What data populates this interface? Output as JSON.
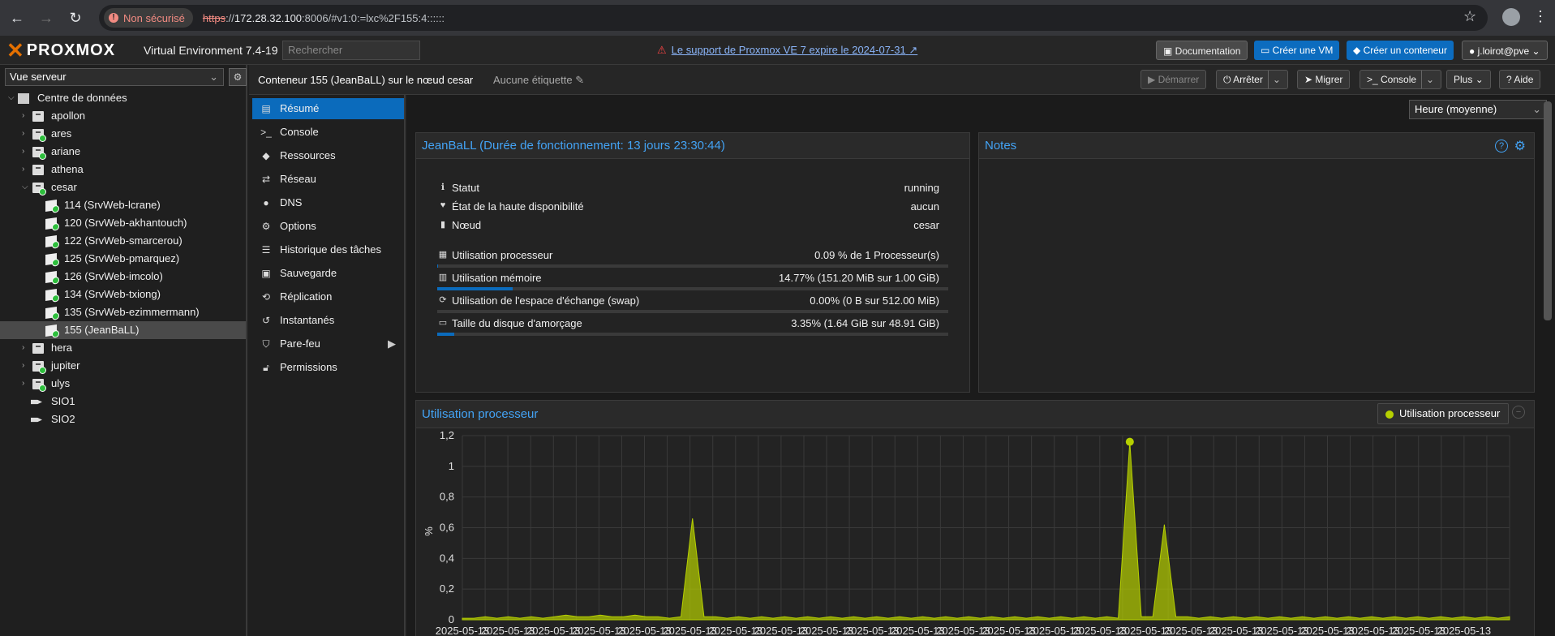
{
  "browser": {
    "insecure_label": "Non sécurisé",
    "url_protocol": "https",
    "url_host": "172.28.32.100",
    "url_rest": ":8006/#v1:0:=lxc%2F155:4::::::"
  },
  "header": {
    "product": "PROXMOX",
    "version": "Virtual Environment 7.4-19",
    "search_placeholder": "Rechercher",
    "support_notice": "Le support de Proxmox VE 7 expire le 2024-07-31",
    "documentation": "Documentation",
    "create_vm": "Créer une VM",
    "create_ct": "Créer un conteneur",
    "user": "j.loirot@pve"
  },
  "tree": {
    "view": "Vue serveur",
    "items": [
      {
        "label": "Centre de données"
      },
      {
        "label": "apollon"
      },
      {
        "label": "ares"
      },
      {
        "label": "ariane"
      },
      {
        "label": "athena"
      },
      {
        "label": "cesar"
      },
      {
        "label": "114 (SrvWeb-lcrane)"
      },
      {
        "label": "120 (SrvWeb-akhantouch)"
      },
      {
        "label": "122 (SrvWeb-smarcerou)"
      },
      {
        "label": "125 (SrvWeb-pmarquez)"
      },
      {
        "label": "126 (SrvWeb-imcolo)"
      },
      {
        "label": "134 (SrvWeb-txiong)"
      },
      {
        "label": "135 (SrvWeb-ezimmermann)"
      },
      {
        "label": "155 (JeanBaLL)"
      },
      {
        "label": "hera"
      },
      {
        "label": "jupiter"
      },
      {
        "label": "ulys"
      },
      {
        "label": "SIO1"
      },
      {
        "label": "SIO2"
      }
    ]
  },
  "toolbar": {
    "title": "Conteneur 155 (JeanBaLL) sur le nœud cesar",
    "tags": "Aucune étiquette",
    "start": "Démarrer",
    "stop": "Arrêter",
    "migrate": "Migrer",
    "console": "Console",
    "more": "Plus",
    "help": "Aide"
  },
  "nav": [
    {
      "label": "Résumé"
    },
    {
      "label": "Console"
    },
    {
      "label": "Ressources"
    },
    {
      "label": "Réseau"
    },
    {
      "label": "DNS"
    },
    {
      "label": "Options"
    },
    {
      "label": "Historique des tâches"
    },
    {
      "label": "Sauvegarde"
    },
    {
      "label": "Réplication"
    },
    {
      "label": "Instantanés"
    },
    {
      "label": "Pare-feu"
    },
    {
      "label": "Permissions"
    }
  ],
  "timeframe": "Heure (moyenne)",
  "status_panel": {
    "title": "JeanBaLL (Durée de fonctionnement: 13 jours 23:30:44)",
    "rows": [
      {
        "key": "Statut",
        "value": "running"
      },
      {
        "key": "État de la haute disponibilité",
        "value": "aucun"
      },
      {
        "key": "Nœud",
        "value": "cesar"
      },
      {
        "key": "Utilisation processeur",
        "value": "0.09 % de 1 Processeur(s)",
        "percent": 0.09
      },
      {
        "key": "Utilisation mémoire",
        "value": "14.77% (151.20 MiB sur 1.00 GiB)",
        "percent": 14.77
      },
      {
        "key": "Utilisation de l'espace d'échange (swap)",
        "value": "0.00% (0 B sur 512.00 MiB)",
        "percent": 0
      },
      {
        "key": "Taille du disque d'amorçage",
        "value": "3.35% (1.64 GiB sur 48.91 GiB)",
        "percent": 3.35
      }
    ]
  },
  "notes_panel": {
    "title": "Notes"
  },
  "chart_panel": {
    "title": "Utilisation processeur",
    "legend": "Utilisation processeur"
  },
  "chart_data": {
    "type": "area",
    "title": "Utilisation processeur",
    "ylabel": "%",
    "ylim": [
      0,
      1.2
    ],
    "yticks": [
      "1,2",
      "1",
      "0,8",
      "0,6",
      "0,4",
      "0,2",
      "0"
    ],
    "xtick_label": "2025-05-13",
    "series": [
      {
        "name": "Utilisation processeur",
        "values": [
          0.01,
          0.01,
          0.02,
          0.01,
          0.02,
          0.01,
          0.02,
          0.01,
          0.02,
          0.03,
          0.02,
          0.02,
          0.03,
          0.02,
          0.02,
          0.03,
          0.02,
          0.02,
          0.01,
          0.02,
          0.66,
          0.02,
          0.02,
          0.01,
          0.02,
          0.01,
          0.02,
          0.01,
          0.02,
          0.01,
          0.02,
          0.01,
          0.02,
          0.01,
          0.02,
          0.01,
          0.02,
          0.01,
          0.02,
          0.01,
          0.02,
          0.01,
          0.02,
          0.01,
          0.02,
          0.01,
          0.02,
          0.01,
          0.02,
          0.01,
          0.02,
          0.01,
          0.02,
          0.01,
          0.02,
          0.01,
          0.02,
          0.01,
          1.16,
          0.02,
          0.02,
          0.62,
          0.02,
          0.02,
          0.01,
          0.02,
          0.01,
          0.02,
          0.01,
          0.02,
          0.01,
          0.02,
          0.01,
          0.02,
          0.01,
          0.02,
          0.01,
          0.02,
          0.01,
          0.02,
          0.01,
          0.02,
          0.01,
          0.02,
          0.01,
          0.02,
          0.01,
          0.02,
          0.01,
          0.02,
          0.01,
          0.02
        ]
      }
    ],
    "color": "#b6d000"
  }
}
